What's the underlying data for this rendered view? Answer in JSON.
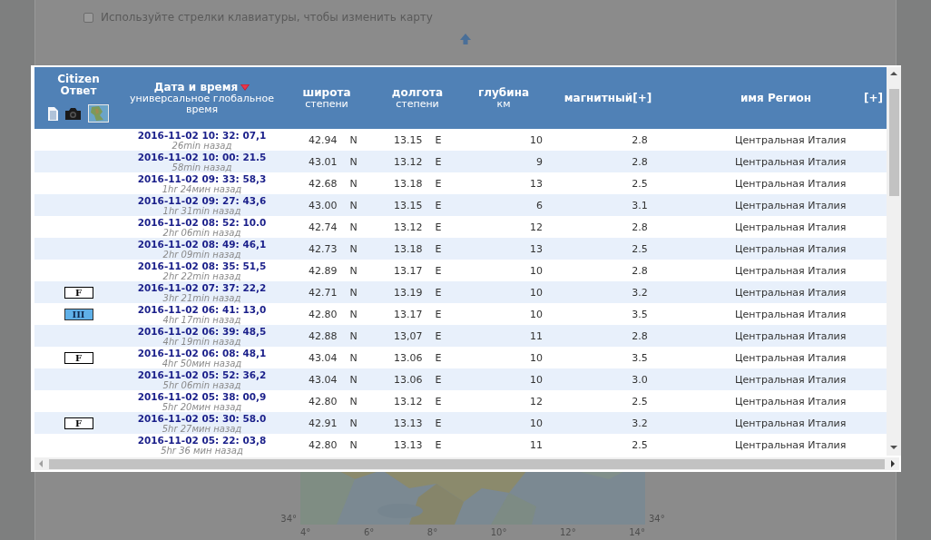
{
  "background": {
    "checkbox": {
      "label": "Используйте стрелки клавиатуры, чтобы изменить карту",
      "checked": false
    },
    "map": {
      "kind": "picture",
      "axis_left": "34°",
      "axis_right": "34°",
      "xticks": [
        "4°",
        "6°",
        "8°",
        "10°",
        "12°",
        "14°"
      ]
    }
  },
  "table": {
    "columns": [
      {
        "kind": "citizen",
        "title": "Citizen",
        "subtitle": "Ответ",
        "sorted": false
      },
      {
        "kind": "date",
        "title": "Дата и время",
        "subtitle": "универсальное глобальное время",
        "sorted": true
      },
      {
        "kind": "lat",
        "title": "широта",
        "subtitle": "степени",
        "sorted": false
      },
      {
        "kind": "lon",
        "title": "долгота",
        "subtitle": "степени",
        "sorted": false
      },
      {
        "kind": "depth",
        "title": "глубина",
        "subtitle": "км",
        "sorted": false
      },
      {
        "kind": "magnitude",
        "title": "магнитный[+]",
        "sorted": false
      },
      {
        "kind": "region",
        "title": "имя Регион",
        "sorted": false
      },
      {
        "kind": "more",
        "title": "[+]",
        "sorted": false
      }
    ],
    "rows": [
      {
        "date": "2016-11-02 10: 32: 07,1",
        "ago": "26min назад",
        "lat": "42.94",
        "lat_dir": "N",
        "lon": "13.15",
        "lon_dir": "E",
        "depth": "10",
        "magnitude": "2.8",
        "region": "Центральная Италия"
      },
      {
        "date": "2016-11-02 10: 00: 21.5",
        "ago": "58min назад",
        "lat": "43.01",
        "lat_dir": "N",
        "lon": "13.12",
        "lon_dir": "E",
        "depth": "9",
        "magnitude": "2.8",
        "region": "Центральная Италия"
      },
      {
        "date": "2016-11-02 09: 33: 58,3",
        "ago": "1hr 24мин назад",
        "lat": "42.68",
        "lat_dir": "N",
        "lon": "13.18",
        "lon_dir": "E",
        "depth": "13",
        "magnitude": "2.5",
        "region": "Центральная Италия"
      },
      {
        "date": "2016-11-02 09: 27: 43,6",
        "ago": "1hr 31min назад",
        "lat": "43.00",
        "lat_dir": "N",
        "lon": "13.15",
        "lon_dir": "E",
        "depth": "6",
        "magnitude": "3.1",
        "region": "Центральная Италия"
      },
      {
        "date": "2016-11-02 08: 52: 10.0",
        "ago": "2hr 06min назад",
        "lat": "42.74",
        "lat_dir": "N",
        "lon": "13.12",
        "lon_dir": "E",
        "depth": "12",
        "magnitude": "2.8",
        "region": "Центральная Италия"
      },
      {
        "date": "2016-11-02 08: 49: 46,1",
        "ago": "2hr 09min назад",
        "lat": "42.73",
        "lat_dir": "N",
        "lon": "13.18",
        "lon_dir": "E",
        "depth": "13",
        "magnitude": "2.5",
        "region": "Центральная Италия"
      },
      {
        "date": "2016-11-02 08: 35: 51,5",
        "ago": "2hr 22min назад",
        "lat": "42.89",
        "lat_dir": "N",
        "lon": "13.17",
        "lon_dir": "E",
        "depth": "10",
        "magnitude": "2.8",
        "region": "Центральная Италия"
      },
      {
        "report": {
          "label": "F",
          "kind": "felt"
        },
        "date": "2016-11-02 07: 37: 22,2",
        "ago": "3hr 21min назад",
        "lat": "42.71",
        "lat_dir": "N",
        "lon": "13.19",
        "lon_dir": "E",
        "depth": "10",
        "magnitude": "3.2",
        "region": "Центральная Италия"
      },
      {
        "report": {
          "label": "III",
          "kind": "intensity"
        },
        "date": "2016-11-02 06: 41: 13,0",
        "ago": "4hr 17min назад",
        "lat": "42.80",
        "lat_dir": "N",
        "lon": "13.17",
        "lon_dir": "E",
        "depth": "10",
        "magnitude": "3.5",
        "region": "Центральная Италия"
      },
      {
        "date": "2016-11-02 06: 39: 48,5",
        "ago": "4hr 19min назад",
        "lat": "42.88",
        "lat_dir": "N",
        "lon": "13,07",
        "lon_dir": "E",
        "depth": "11",
        "magnitude": "2.8",
        "region": "Центральная Италия"
      },
      {
        "report": {
          "label": "F",
          "kind": "felt"
        },
        "date": "2016-11-02 06: 08: 48,1",
        "ago": "4hr 50мин назад",
        "lat": "43.04",
        "lat_dir": "N",
        "lon": "13.06",
        "lon_dir": "E",
        "depth": "10",
        "magnitude": "3.5",
        "region": "Центральная Италия"
      },
      {
        "date": "2016-11-02 05: 52: 36,2",
        "ago": "5hr 06min назад",
        "lat": "43.04",
        "lat_dir": "N",
        "lon": "13.06",
        "lon_dir": "E",
        "depth": "10",
        "magnitude": "3.0",
        "region": "Центральная Италия"
      },
      {
        "date": "2016-11-02 05: 38: 00,9",
        "ago": "5hr 20мин назад",
        "lat": "42.80",
        "lat_dir": "N",
        "lon": "13.12",
        "lon_dir": "E",
        "depth": "12",
        "magnitude": "2.5",
        "region": "Центральная Италия"
      },
      {
        "report": {
          "label": "F",
          "kind": "felt"
        },
        "date": "2016-11-02 05: 30: 58.0",
        "ago": "5hr 27мин назад",
        "lat": "42.91",
        "lat_dir": "N",
        "lon": "13.13",
        "lon_dir": "E",
        "depth": "10",
        "magnitude": "3.2",
        "region": "Центральная Италия"
      },
      {
        "date": "2016-11-02 05: 22: 03,8",
        "ago": "5hr 36 мин назад",
        "lat": "42.80",
        "lat_dir": "N",
        "lon": "13.13",
        "lon_dir": "E",
        "depth": "11",
        "magnitude": "2.5",
        "region": "Центральная Италия"
      }
    ]
  }
}
